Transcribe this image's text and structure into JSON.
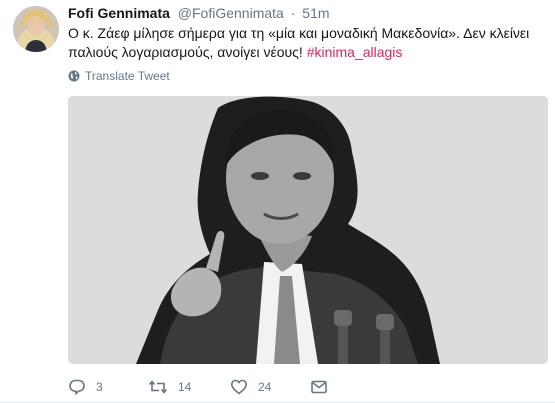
{
  "user": {
    "display_name": "Fofi Gennimata",
    "handle": "@FofiGennimata",
    "separator": "·",
    "time": "51m"
  },
  "tweet": {
    "text_main": "Ο κ. Ζάεφ μίλησε σήμερα για τη «μία και μοναδική Μακεδονία». Δεν κλείνει παλιούς λογαριασμούς, ανοίγει νέους! ",
    "hashtag": "#kinima_allagis"
  },
  "translate": {
    "label": "Translate Tweet",
    "icon": "globe-icon"
  },
  "actions": {
    "replies": "3",
    "retweets": "14",
    "likes": "24",
    "reply_icon": "reply-icon",
    "retweet_icon": "retweet-icon",
    "like_icon": "heart-icon",
    "dm_icon": "direct-message-icon"
  },
  "colors": {
    "text": "#14171a",
    "secondary": "#657786",
    "hashtag": "#e0245e",
    "media_background": "#dcdcdc"
  }
}
